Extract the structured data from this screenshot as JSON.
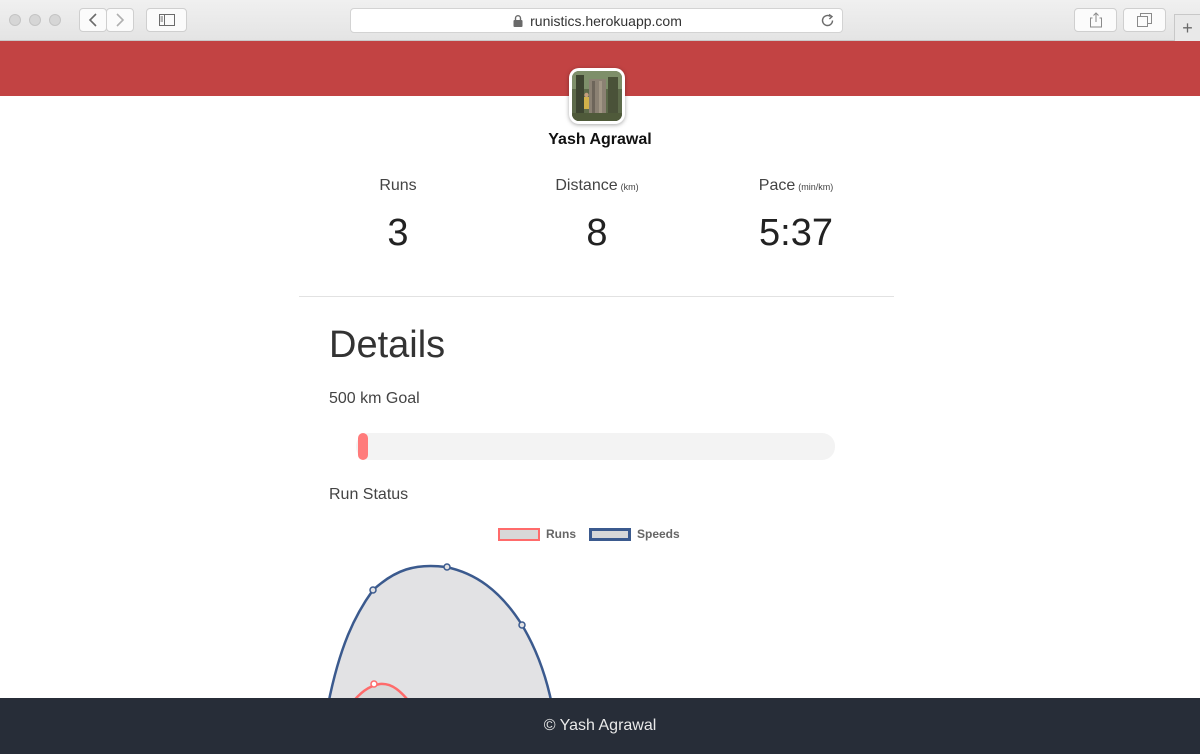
{
  "browser": {
    "url": "runistics.herokuapp.com"
  },
  "profile": {
    "name": "Yash Agrawal"
  },
  "stats": [
    {
      "label": "Runs",
      "unit": "",
      "value": "3"
    },
    {
      "label": "Distance",
      "unit": "(km)",
      "value": "8"
    },
    {
      "label": "Pace",
      "unit": "(min/km)",
      "value": "5:37"
    }
  ],
  "details": {
    "title": "Details",
    "goal_label": "500 km Goal",
    "goal_progress_fraction": 0.02,
    "status_label": "Run Status"
  },
  "chart_data": {
    "type": "radar",
    "series": [
      {
        "name": "Runs",
        "color": "#ff6b6b"
      },
      {
        "name": "Speeds",
        "color": "#3b5a8e"
      }
    ]
  },
  "colors": {
    "banner": "#c24343",
    "progress": "#ff7b7b",
    "footer": "#272d38"
  },
  "footer": {
    "text": "© Yash Agrawal"
  }
}
